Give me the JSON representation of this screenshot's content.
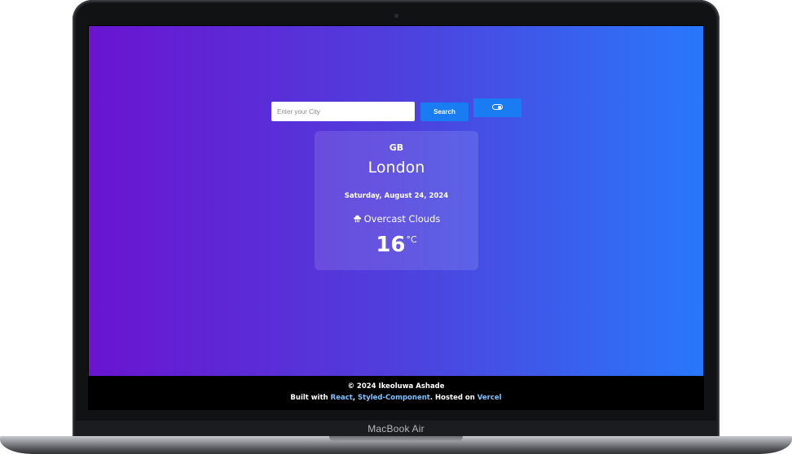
{
  "device": {
    "label": "MacBook Air"
  },
  "search": {
    "placeholder": "Enter your City",
    "value": "",
    "button_label": "Search"
  },
  "theme_toggle": {
    "icon": "toggle-icon",
    "state": "on"
  },
  "weather": {
    "country": "GB",
    "city": "London",
    "date": "Saturday, August 24, 2024",
    "icon": "cloud-rain-icon",
    "description": "Overcast Clouds",
    "temperature": "16",
    "unit": "°C"
  },
  "footer": {
    "copyright": "© 2024 Ikeoluwa Ashade",
    "built_with_prefix": "Built with ",
    "link_react": "React",
    "separator": ", ",
    "link_styled": "Styled-Component",
    "hosted_on_text": ". Hosted on ",
    "link_vercel": "Vercel"
  },
  "colors": {
    "gradient_start": "#6a14d0",
    "gradient_end": "#2978fb",
    "button": "#1a7cf2",
    "link": "#7fc2ff",
    "footer_bg": "#000000"
  }
}
